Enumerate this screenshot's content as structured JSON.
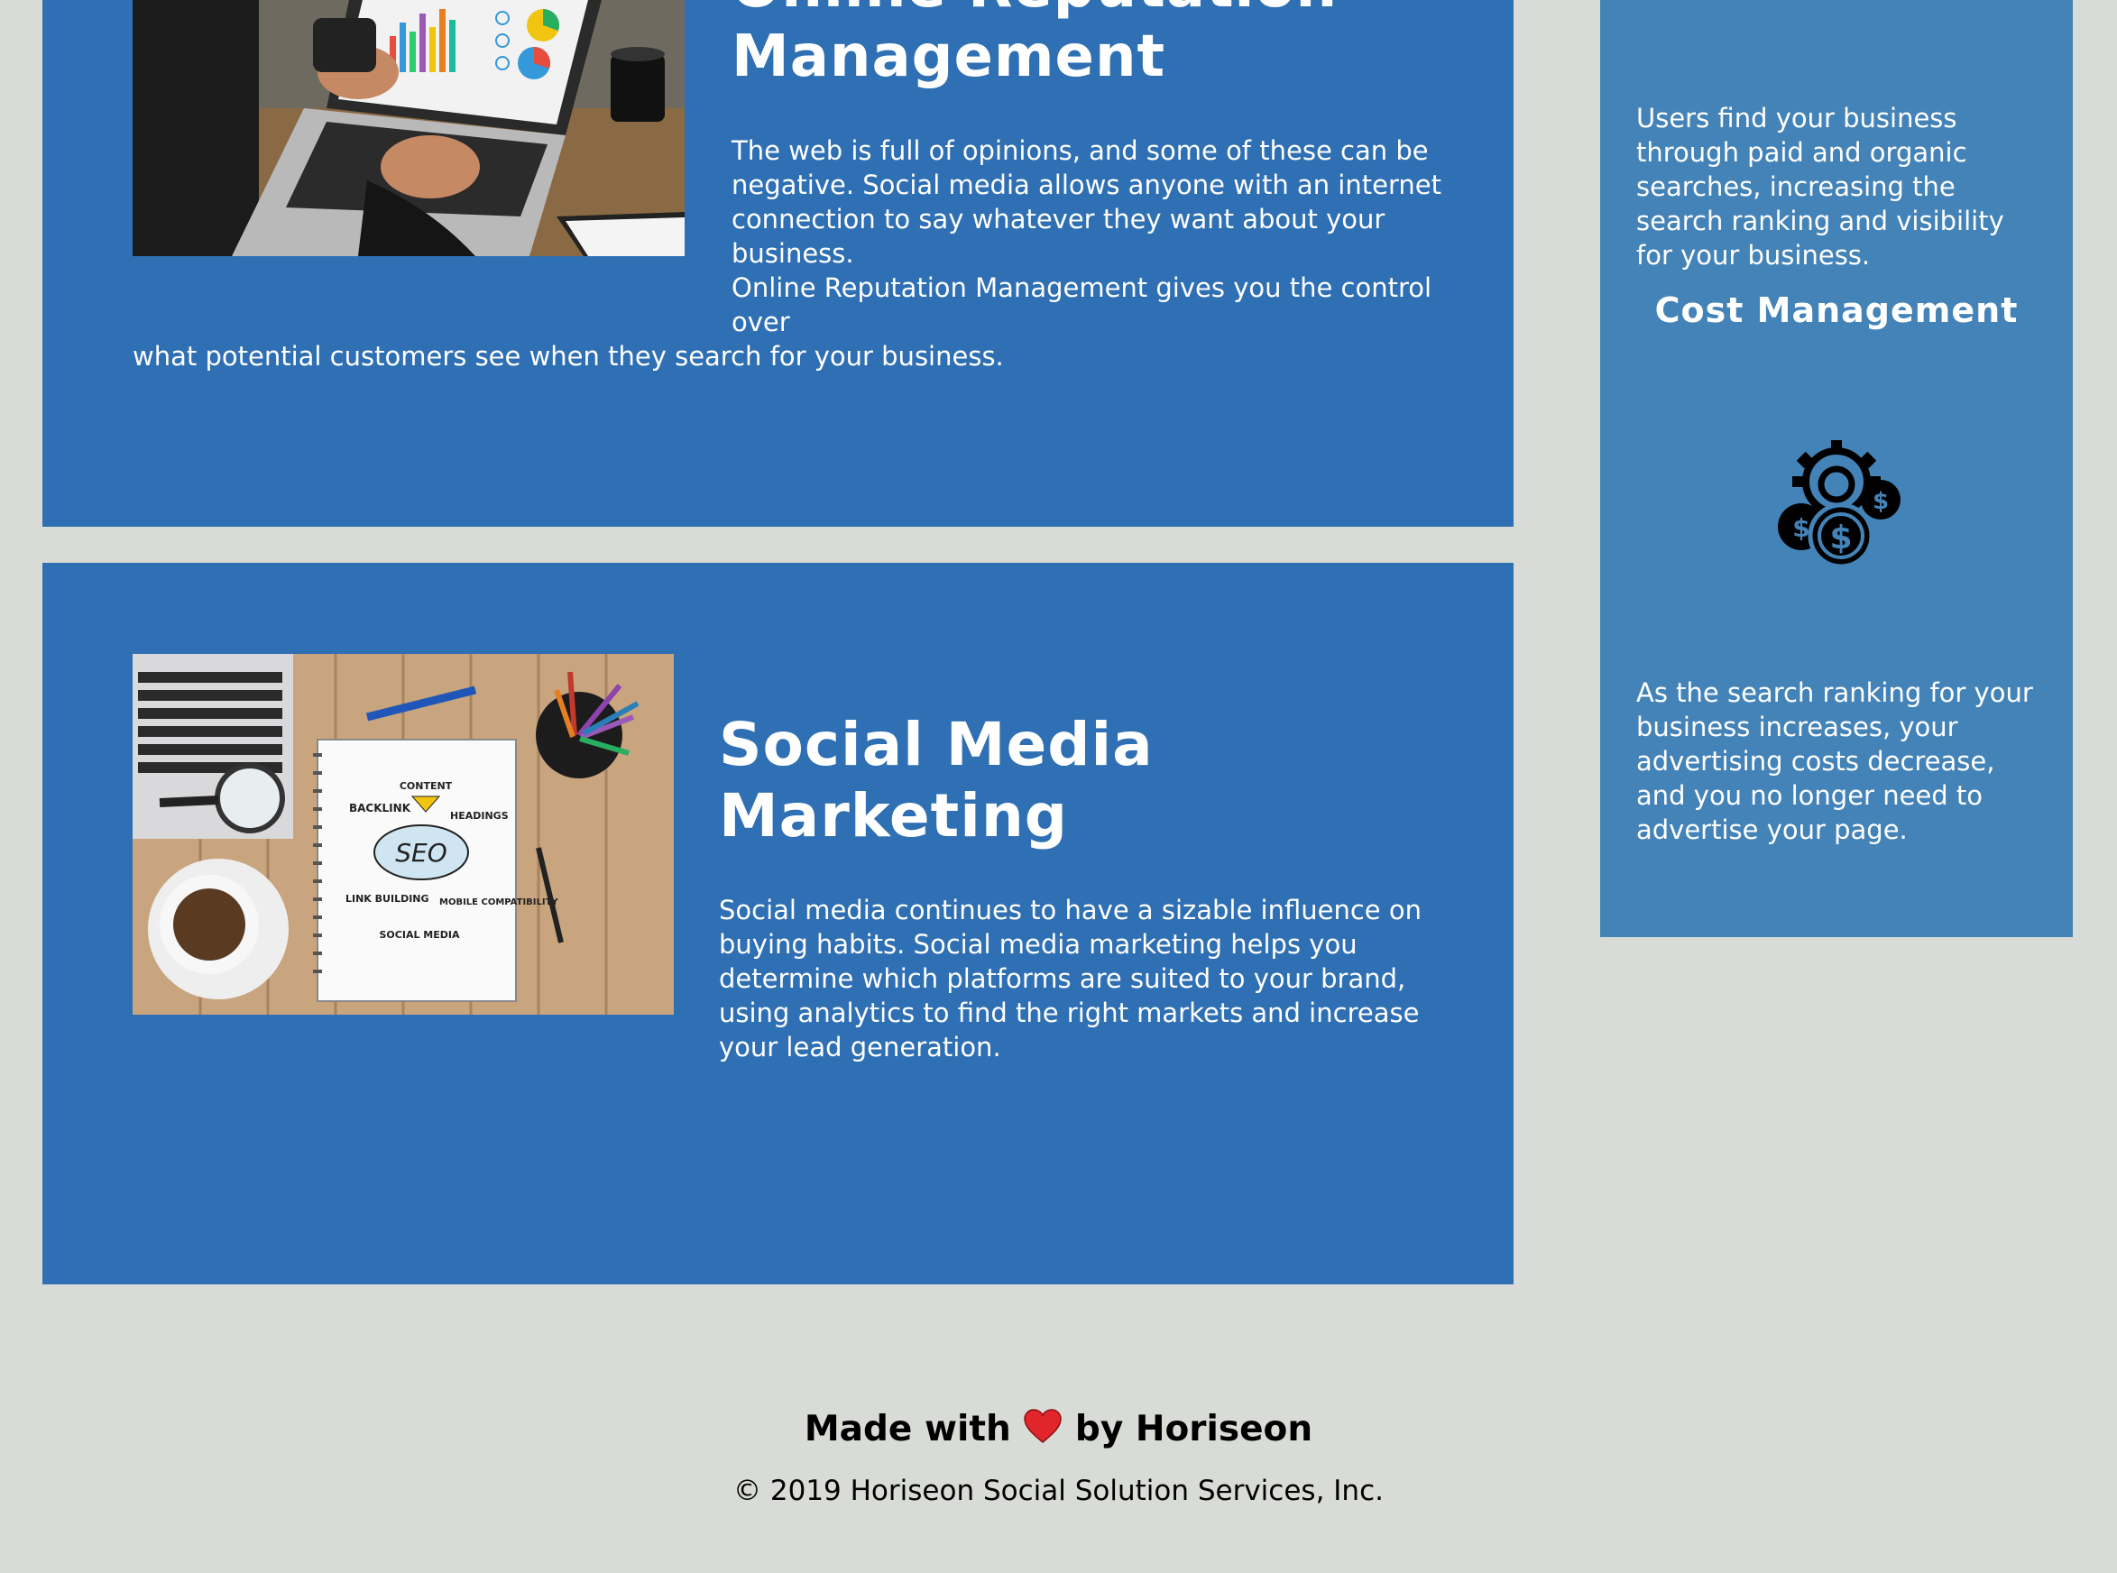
{
  "cards": [
    {
      "title": "Online Reputation Management",
      "text_lines": [
        "The web is full of opinions, and some of these can be",
        "negative. Social media allows anyone with an internet",
        "connection to say whatever they want about your business.",
        "Online Reputation Management gives you the control over",
        "what potential customers see when they search for your business."
      ]
    },
    {
      "title": "Social Media Marketing",
      "text": "Social media continues to have a sizable influence on buying habits. Social media marketing helps you determine which platforms are suited to your brand, using analytics to find the right markets and increase your lead generation.",
      "image_words": {
        "content": "CONTENT",
        "backlink": "BACKLINK",
        "headings": "HEADINGS",
        "seo": "SEO",
        "link_building": "LINK BUILDING",
        "mobile": "MOBILE COMPATIBILITY",
        "social": "SOCIAL MEDIA"
      }
    }
  ],
  "sidebar": {
    "text_1": "Users find your business through paid and organic searches, increasing the search ranking and visibility for your business.",
    "heading": "Cost Management",
    "icon": "cost-management-icon",
    "text_2": "As the search ranking for your business increases, your advertising costs decrease, and you no longer need to advertise your page."
  },
  "footer": {
    "made_with": "Made with",
    "by": "by Horiseon",
    "copyright": "© 2019 Horiseon Social Solution Services, Inc."
  },
  "colors": {
    "background": "#d9dcd6",
    "card": "#2f6fb3",
    "sidebar": "#4483b8",
    "heart": "#e0262b"
  }
}
